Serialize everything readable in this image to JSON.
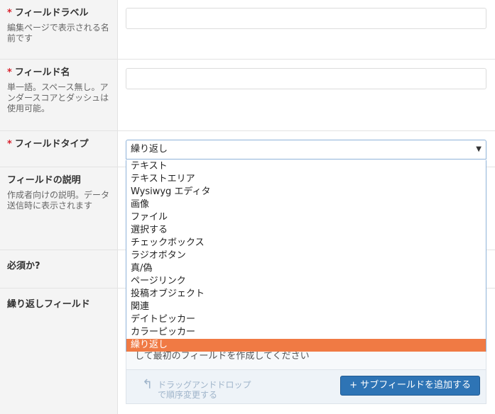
{
  "fields": [
    {
      "label": "フィールドラベル",
      "required": "*",
      "help": "編集ページで表示される名前です"
    },
    {
      "label": "フィールド名",
      "required": "*",
      "help": "単一語。スペース無し。アンダースコアとダッシュは使用可能。"
    },
    {
      "label": "フィールドタイプ",
      "required": "*",
      "help": ""
    },
    {
      "label": "フィールドの説明",
      "required": "",
      "help": "作成者向けの説明。データ送信時に表示されます"
    },
    {
      "label": "必須か?",
      "required": "",
      "help": ""
    },
    {
      "label": "繰り返しフィールド",
      "required": "",
      "help": ""
    }
  ],
  "field_type_select": {
    "selected": "繰り返し",
    "arrow": "▼",
    "options": [
      "テキスト",
      "テキストエリア",
      "Wysiwyg エディタ",
      "画像",
      "ファイル",
      "選択する",
      "チェックボックス",
      "ラジオボタン",
      "真/偽",
      "ページリンク",
      "投稿オブジェクト",
      "関連",
      "デイトピッカー",
      "カラーピッカー",
      "繰り返し"
    ]
  },
  "repeater": {
    "empty_message": "して最初のフィールドを作成してください",
    "drag_hint_line1": "ドラッグアンドドロップ",
    "drag_hint_line2": "で順序変更する",
    "add_button": "+ サブフィールドを追加する"
  },
  "colors": {
    "accent": "#f07a44",
    "button": "#2e74b5",
    "required": "#d9232e"
  }
}
